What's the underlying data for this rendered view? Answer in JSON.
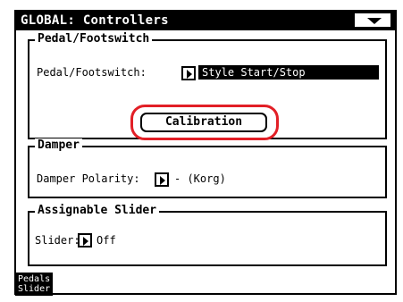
{
  "window": {
    "title": "GLOBAL: Controllers"
  },
  "pedal": {
    "group_title": "Pedal/Footswitch",
    "field_label": "Pedal/Footswitch:",
    "value": "Style Start/Stop",
    "calibration_label": "Calibration"
  },
  "damper": {
    "group_title": "Damper",
    "field_label": "Damper Polarity:",
    "value": "- (Korg)"
  },
  "slider": {
    "group_title": "Assignable Slider",
    "field_label": "Slider:",
    "value": "Off"
  },
  "tabs": [
    {
      "line1": "Pedals",
      "line2": "Slider"
    }
  ],
  "colors": {
    "highlight_ring": "#e21f26",
    "screen_bg": "#ffffff",
    "ink": "#000000"
  }
}
